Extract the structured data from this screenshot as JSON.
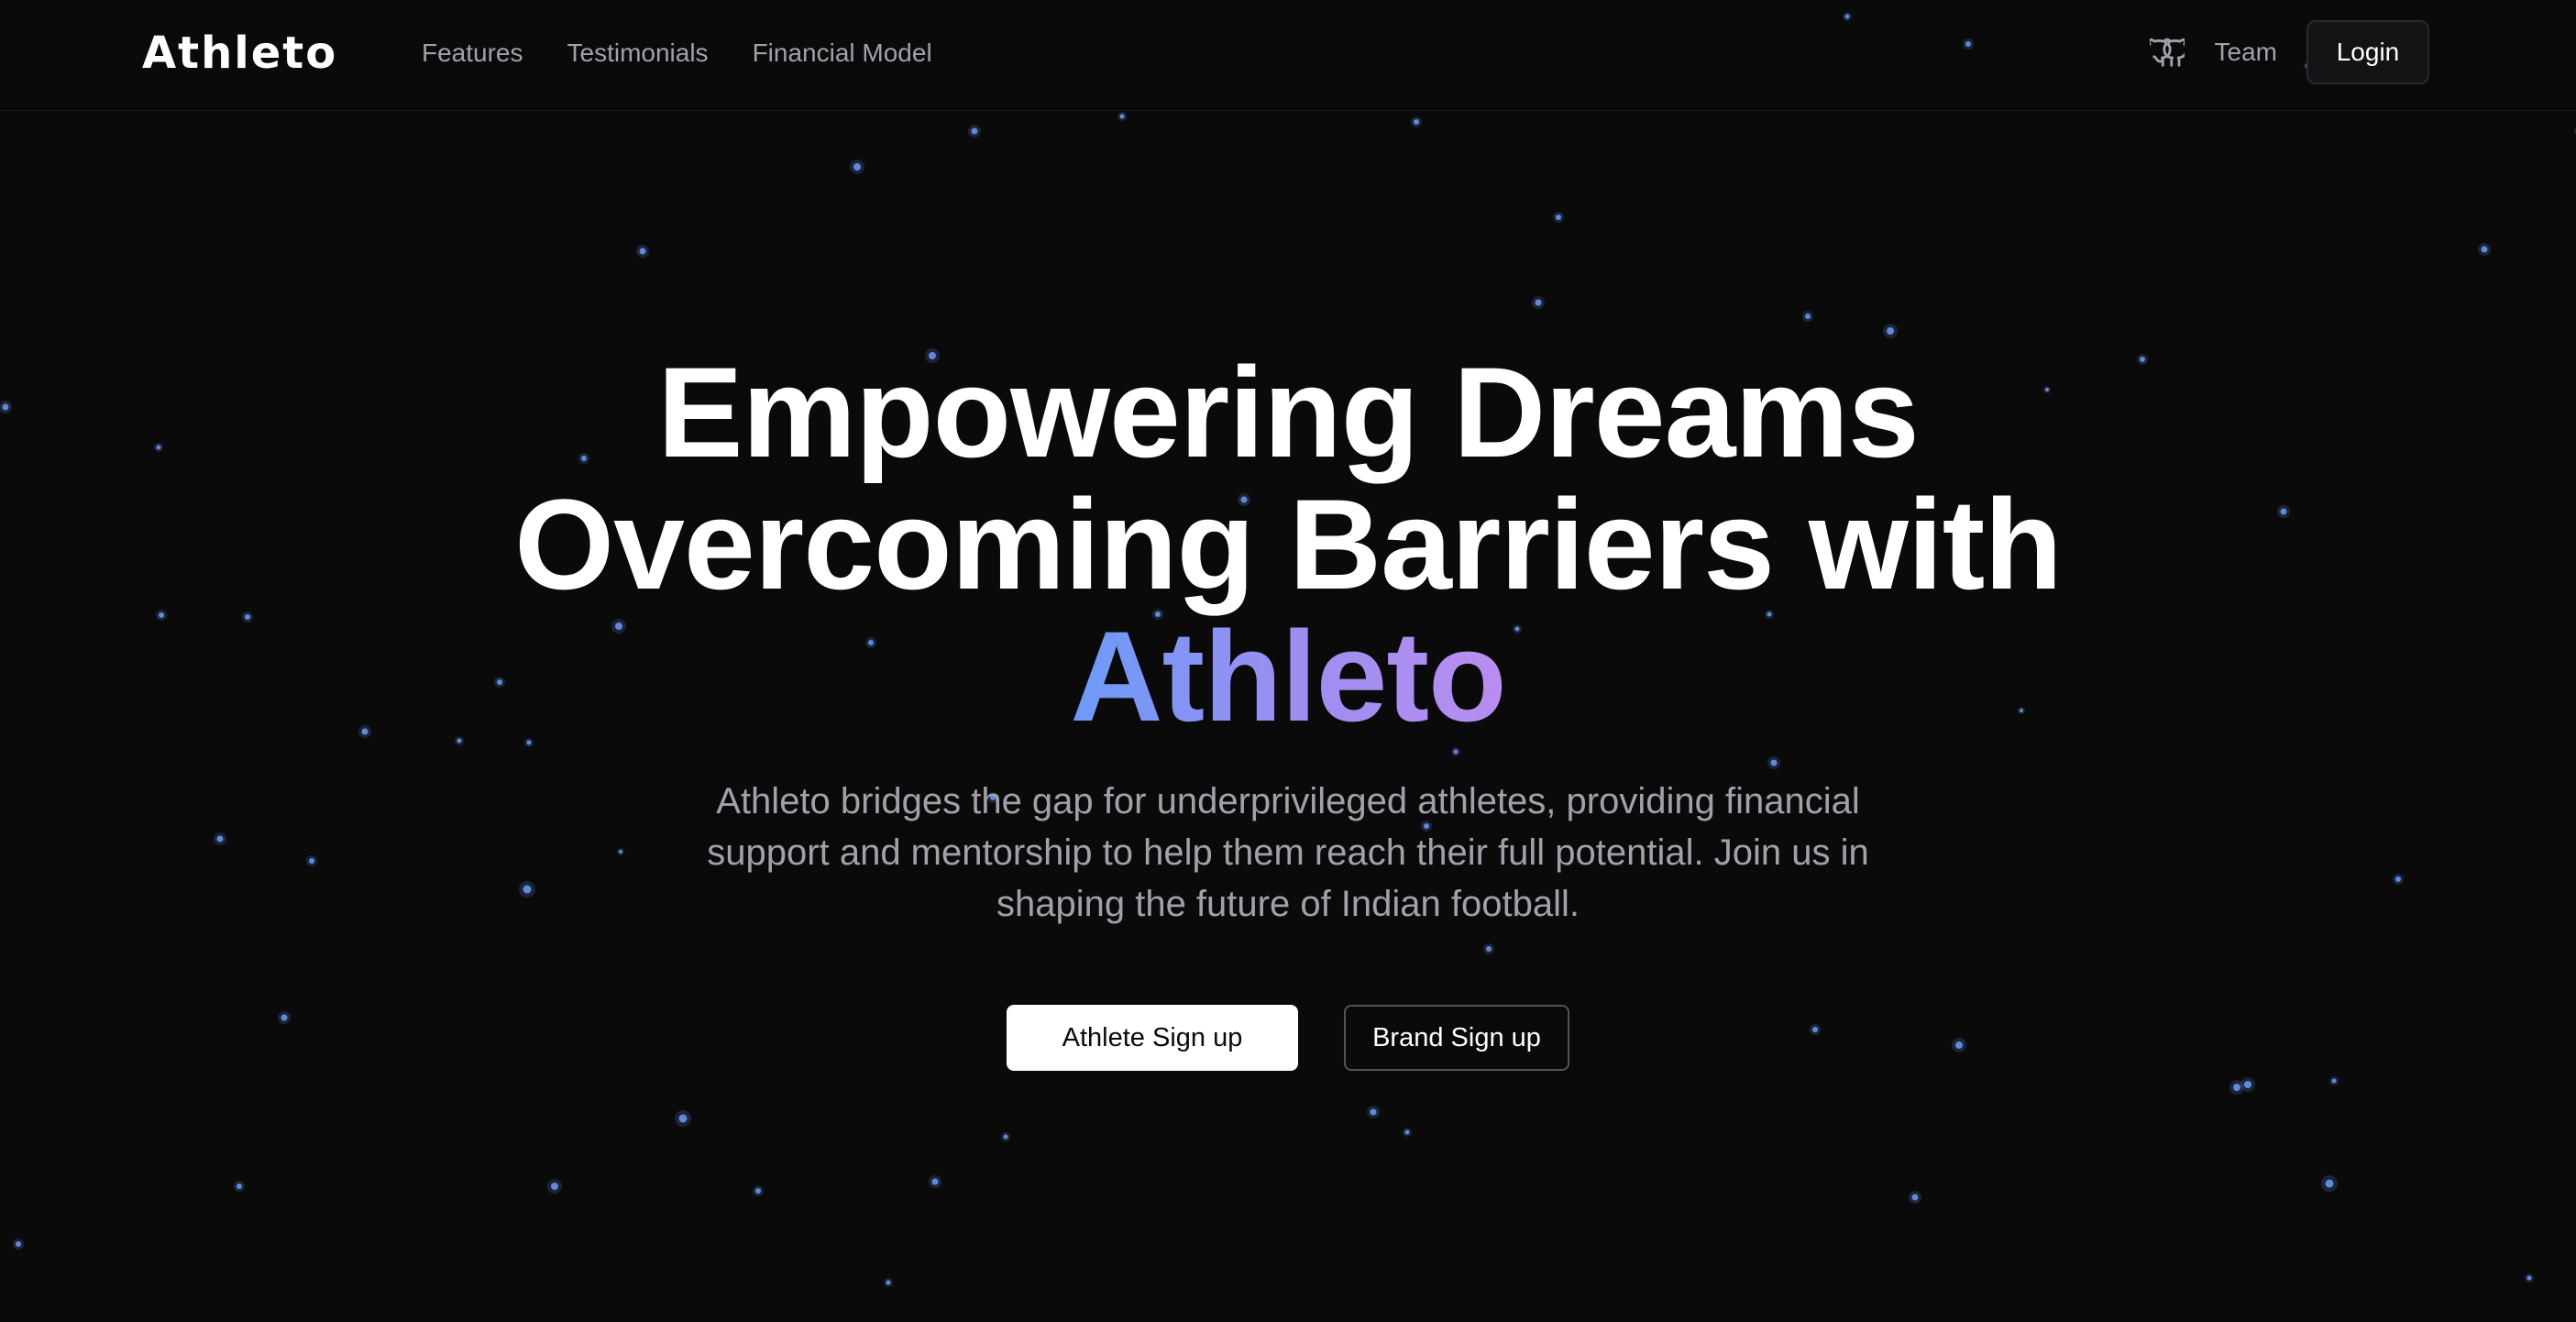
{
  "brand": {
    "logo": "Athleto"
  },
  "nav": {
    "links": [
      "Features",
      "Testimonials",
      "Financial Model"
    ],
    "github_icon": "github-icon",
    "team": "Team",
    "login": "Login"
  },
  "hero": {
    "title_line1": "Empowering Dreams",
    "title_line2": "Overcoming Barriers with",
    "title_highlight": "Athleto",
    "subtitle": "Athleto bridges the gap for underprivileged athletes, providing financial support and mentorship to help them reach their full potential. Join us in shaping the future of Indian football.",
    "cta_primary": "Athlete Sign up",
    "cta_secondary": "Brand Sign up"
  },
  "colors": {
    "background": "#0a0a0b",
    "star": "#6b9bf8",
    "gradient_start": "#6b9bf8",
    "gradient_end": "#b98ef0",
    "muted_text": "#a1a1aa"
  }
}
